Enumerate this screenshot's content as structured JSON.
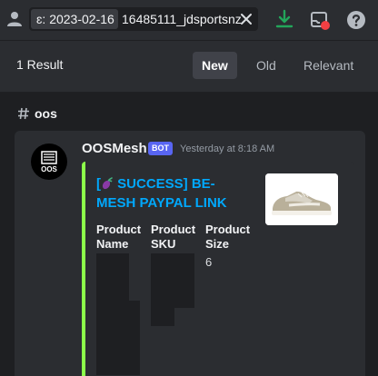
{
  "topbar": {
    "search_date": "2023-02-16",
    "search_date_prefix": "ɛ:",
    "search_query": "16485111_jdsportsnz",
    "icons": [
      "members-icon",
      "clear-icon",
      "download-icon",
      "inbox-icon",
      "help-icon"
    ]
  },
  "results": {
    "count_label": "1 Result",
    "sort_options": [
      "New",
      "Old",
      "Relevant"
    ],
    "selected_sort": "New"
  },
  "channel": {
    "name": "oos"
  },
  "message": {
    "author": "OOSMesh",
    "bot_tag": "BOT",
    "timestamp": "Yesterday at 8:18 AM",
    "avatar_text": "OOS",
    "embed": {
      "accent_color": "#8cff4a",
      "title_prefix": "[",
      "title_rest": " SUCCESS] BE-MESH PAYPAL LINK",
      "emoji": "eggplant-icon",
      "fields": [
        {
          "name": "Product Name",
          "value": ""
        },
        {
          "name": "Product SKU",
          "value": ""
        },
        {
          "name": "Product Size",
          "value": "6"
        }
      ]
    }
  },
  "colors": {
    "bot_tag": "#5865f2",
    "link": "#00a8fc",
    "download": "#23a55a",
    "notify_dot": "#f23f43"
  }
}
